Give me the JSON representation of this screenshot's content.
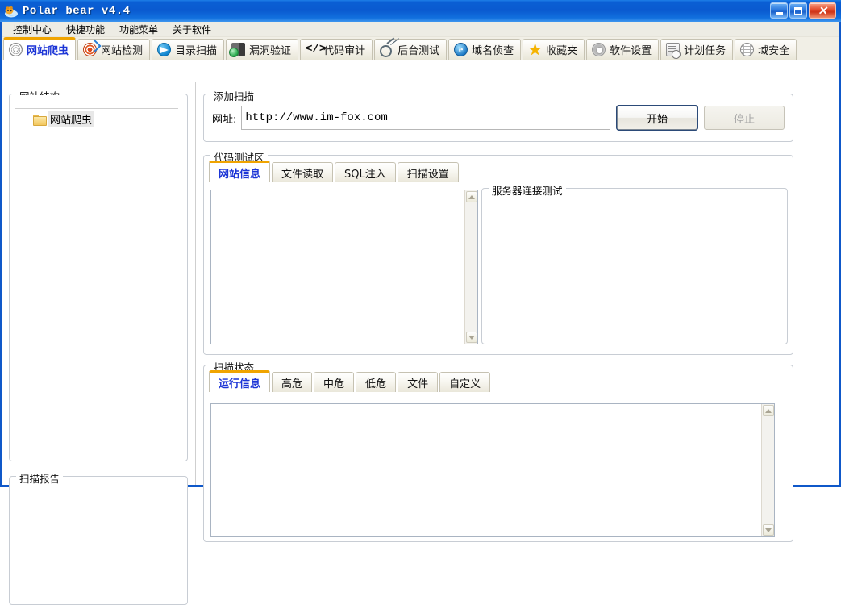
{
  "window": {
    "title": "Polar bear v4.4",
    "icon": "polar-bear-icon",
    "buttons": {
      "minimize": "_",
      "maximize": "□",
      "close": "✕"
    }
  },
  "menubar": {
    "items": [
      {
        "label": "控制中心"
      },
      {
        "label": "快捷功能"
      },
      {
        "label": "功能菜单"
      },
      {
        "label": "关于软件"
      }
    ]
  },
  "toolbar_tabs": [
    {
      "label": "网站爬虫",
      "icon": "spider-web-icon",
      "active": true
    },
    {
      "label": "网站检测",
      "icon": "target-dart-icon",
      "active": false
    },
    {
      "label": "目录扫描",
      "icon": "send-arrow-icon",
      "active": false
    },
    {
      "label": "漏洞验证",
      "icon": "server-check-icon",
      "active": false
    },
    {
      "label": "代码审计",
      "icon": "code-brackets-icon",
      "active": false
    },
    {
      "label": "后台测试",
      "icon": "key-icon",
      "active": false
    },
    {
      "label": "域名侦查",
      "icon": "ie-browser-icon",
      "active": false
    },
    {
      "label": "收藏夹",
      "icon": "star-icon",
      "active": false
    },
    {
      "label": "软件设置",
      "icon": "gear-icon",
      "active": false
    },
    {
      "label": "计划任务",
      "icon": "clipboard-clock-icon",
      "active": false
    },
    {
      "label": "域安全",
      "icon": "globe-icon",
      "active": false
    }
  ],
  "left_panel": {
    "structure_group": {
      "legend": "网站结构",
      "tree": [
        {
          "label": "网站爬虫",
          "icon": "folder-icon",
          "selected": true
        }
      ]
    },
    "report_group": {
      "legend": "扫描报告"
    }
  },
  "add_scan": {
    "legend": "添加扫描",
    "url_label": "网址:",
    "url_value": "http://www.im-fox.com",
    "url_placeholder": "",
    "start_button": "开始",
    "stop_button": "停止",
    "stop_disabled": true
  },
  "code_test": {
    "legend": "代码测试区",
    "tabs": [
      {
        "label": "网站信息",
        "active": true
      },
      {
        "label": "文件读取",
        "active": false
      },
      {
        "label": "SQL注入",
        "active": false
      },
      {
        "label": "扫描设置",
        "active": false
      }
    ],
    "textarea_value": "",
    "server_group": {
      "legend": "服务器连接测试",
      "content": ""
    }
  },
  "scan_status": {
    "legend": "扫描状态",
    "tabs": [
      {
        "label": "运行信息",
        "active": true
      },
      {
        "label": "高危",
        "active": false
      },
      {
        "label": "中危",
        "active": false
      },
      {
        "label": "低危",
        "active": false
      },
      {
        "label": "文件",
        "active": false
      },
      {
        "label": "自定义",
        "active": false
      }
    ],
    "log_value": ""
  },
  "colors": {
    "titlebar_blue": "#0a5fd4",
    "active_tab_accent": "#f0a400",
    "active_tab_text": "#1c35d6",
    "toolbar_bg": "#f1efe6",
    "menubar_bg": "#edece4"
  }
}
